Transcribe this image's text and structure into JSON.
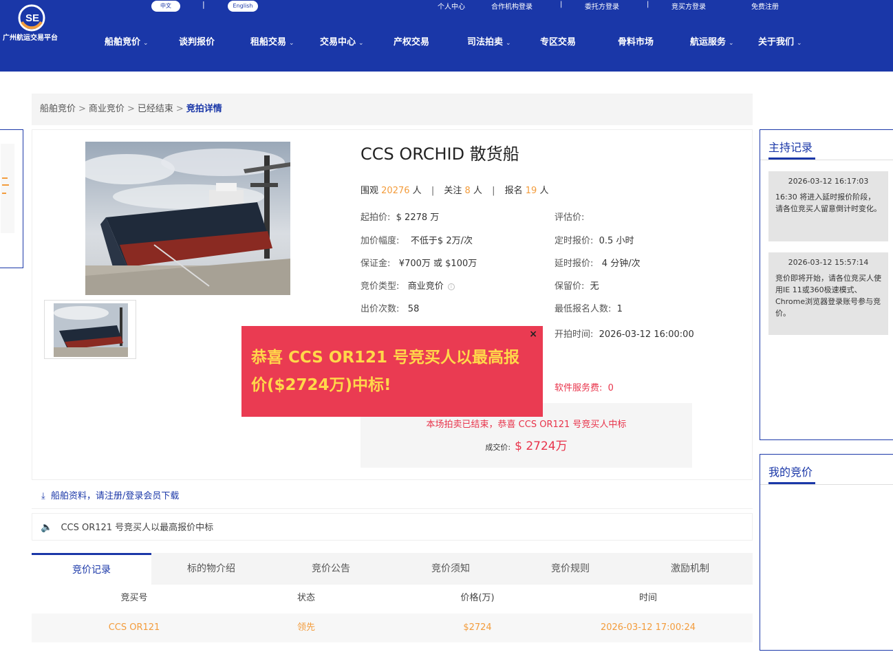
{
  "header": {
    "logo_text": "广州航运交易平台",
    "lang_cn": "中文",
    "lang_sep": "|",
    "lang_en": "English",
    "top_links": [
      "个人中心",
      "合作机构登录",
      "|",
      "委托方登录",
      "|",
      "竞买方登录",
      "免费注册"
    ],
    "nav": [
      {
        "label": "船舶竞价",
        "chevron": "⌄"
      },
      {
        "label": "谈判报价",
        "chevron": ""
      },
      {
        "label": "租船交易",
        "chevron": "⌄"
      },
      {
        "label": "交易中心",
        "chevron": "⌄"
      },
      {
        "label": "产权交易",
        "chevron": ""
      },
      {
        "label": "司法拍卖",
        "chevron": "⌄"
      },
      {
        "label": "专区交易",
        "chevron": ""
      },
      {
        "label": "骨料市场",
        "chevron": ""
      },
      {
        "label": "航运服务",
        "chevron": "⌄"
      },
      {
        "label": "关于我们",
        "chevron": "⌄"
      }
    ]
  },
  "breadcrumb": [
    "船舶竞价",
    "商业竞价",
    "已经结束",
    "竞拍详情"
  ],
  "breadcrumb_sep": ">",
  "ship": {
    "title": "CCS ORCHID 散货船",
    "stats": {
      "views_label": "围观",
      "views": "20276",
      "views_unit": "人",
      "follow_label": "关注",
      "follow": "8",
      "follow_unit": "人",
      "signup_label": "报名",
      "signup": "19",
      "signup_unit": "人",
      "sep": "|"
    },
    "fields": {
      "start_price": {
        "label": "起拍价:",
        "value": "$ 2278 万"
      },
      "increment": {
        "label": "加价幅度:",
        "value": "不低于$ 2万/次"
      },
      "deposit": {
        "label": "保证金:",
        "value": "¥700万 或 $100万"
      },
      "type": {
        "label": "竞价类型:",
        "value": "商业竞价"
      },
      "bids": {
        "label": "出价次数:",
        "value": "58"
      },
      "eval": {
        "label": "评估价:",
        "value": ""
      },
      "timed": {
        "label": "定时报价:",
        "value": "0.5 小时"
      },
      "delay": {
        "label": "延时报价:",
        "value": "4 分钟/次"
      },
      "reserve": {
        "label": "保留价:",
        "value": "无"
      },
      "min_signup": {
        "label": "最低报名人数:",
        "value": "1"
      },
      "start_time": {
        "label": "开拍时间:",
        "value": "2026-03-12 16:00:00"
      }
    },
    "info_icon": "i",
    "fee": {
      "label": "软件服务费:",
      "value": "0"
    }
  },
  "popup": {
    "message": "恭喜 CCS OR121 号竞买人以最高报价($2724万)中标!",
    "close": "×"
  },
  "result": {
    "message": "本场拍卖已结束，恭喜 CCS OR121 号竞买人中标",
    "price_label": "成交价:",
    "price": "$ 2724万"
  },
  "download": {
    "icon": "⤓",
    "text": "船舶资料，请注册/登录会员下载"
  },
  "notice": {
    "icon": "🔈",
    "text": "CCS OR121 号竞买人以最高报价中标"
  },
  "tabs": [
    "竞价记录",
    "标的物介绍",
    "竞价公告",
    "竞价须知",
    "竞价规则",
    "激励机制"
  ],
  "table": {
    "headers": [
      "竞买号",
      "状态",
      "价格(万)",
      "时间"
    ],
    "rows": [
      [
        "CCS OR121",
        "领先",
        "$2724",
        "2026-03-12 17:00:24"
      ]
    ]
  },
  "host_record": {
    "title": "主持记录",
    "messages": [
      {
        "time": "2026-03-12 16:17:03",
        "text": "16:30 将进入延时报价阶段，请各位竞买人留意倒计时变化。"
      },
      {
        "time": "2026-03-12 15:57:14",
        "text": "竞价即将开始，请各位竞买人使用IE 11或360极速模式、Chrome浏览器登录账号参与竞价。"
      }
    ]
  },
  "my_bid": {
    "title": "我的竞价"
  },
  "colors": {
    "brand": "#1a37a8",
    "accent_orange": "#f39c3c",
    "alert_red": "#ea3b52",
    "popup_text": "#ffd84a"
  }
}
